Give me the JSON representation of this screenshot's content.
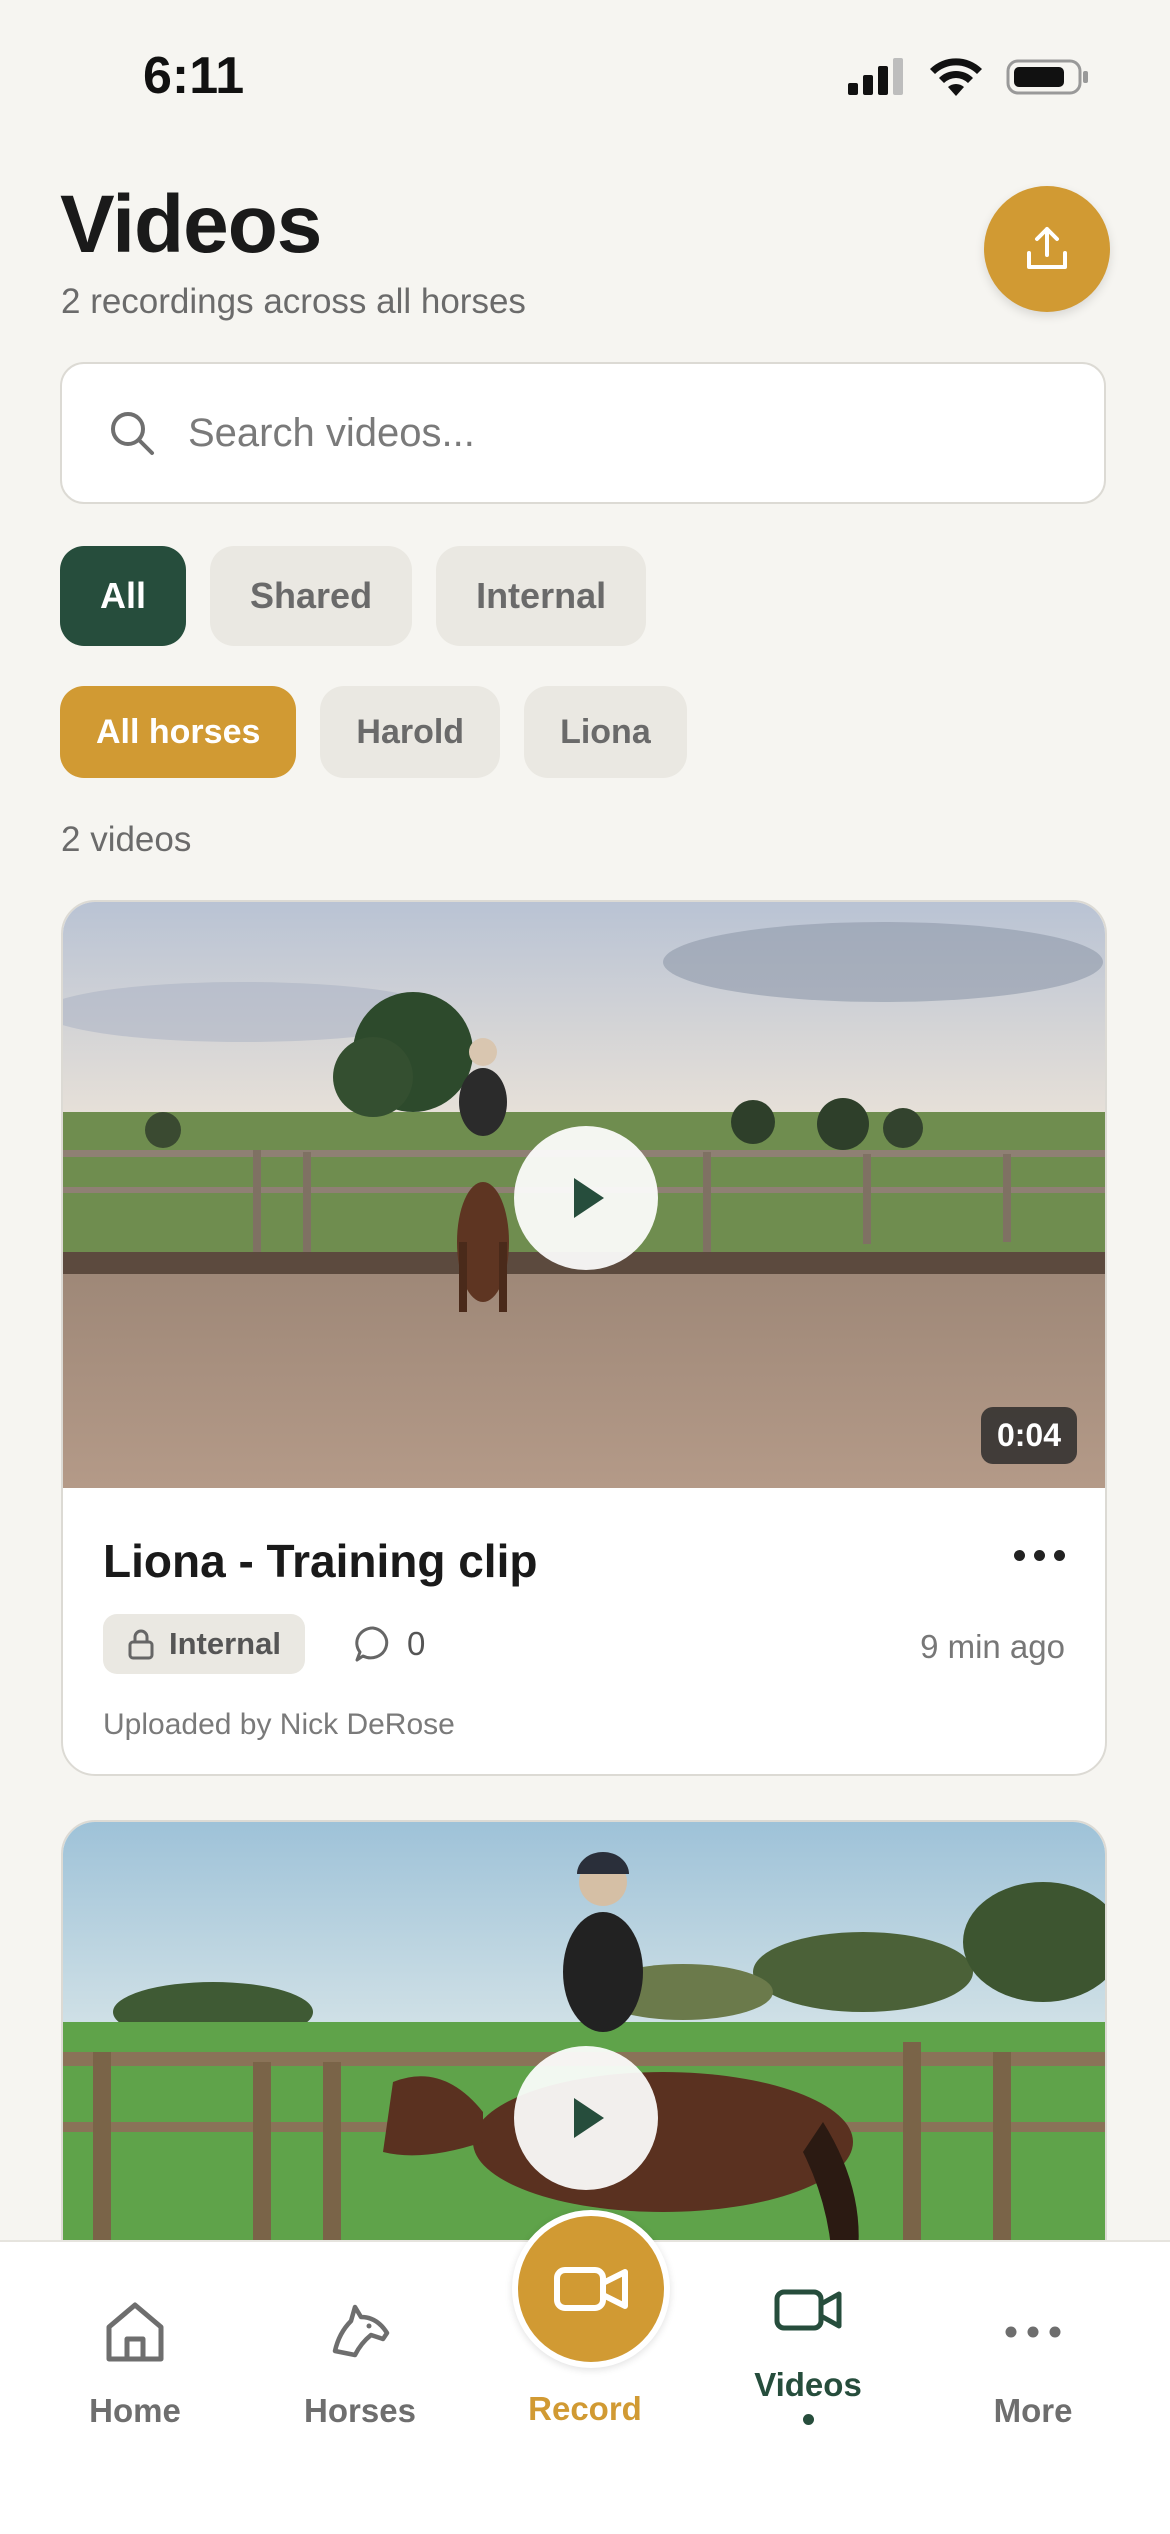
{
  "status_bar": {
    "time": "6:11"
  },
  "header": {
    "title": "Videos",
    "subtitle": "2 recordings across all horses",
    "upload_icon": "upload-icon"
  },
  "search": {
    "placeholder": "Search videos..."
  },
  "visibility_filters": [
    {
      "label": "All",
      "active": true
    },
    {
      "label": "Shared",
      "active": false
    },
    {
      "label": "Internal",
      "active": false
    }
  ],
  "horse_filters": [
    {
      "label": "All horses",
      "active": true
    },
    {
      "label": "Harold",
      "active": false
    },
    {
      "label": "Liona",
      "active": false
    }
  ],
  "video_count": "2 videos",
  "videos": [
    {
      "title": "Liona - Training clip",
      "duration": "0:04",
      "visibility": "Internal",
      "comments": "0",
      "time_ago": "9 min ago",
      "uploader": "Uploaded by Nick DeRose"
    },
    {
      "title": "",
      "duration": "",
      "visibility": "",
      "comments": "",
      "time_ago": "",
      "uploader": ""
    }
  ],
  "tabbar": {
    "home": "Home",
    "horses": "Horses",
    "record": "Record",
    "videos": "Videos",
    "more": "More"
  },
  "colors": {
    "accent_gold": "#d19a33",
    "accent_green": "#264d3c",
    "background": "#f6f5f1"
  }
}
